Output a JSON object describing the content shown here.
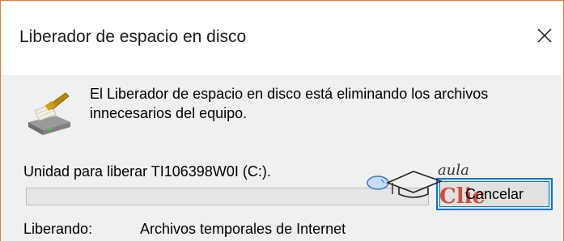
{
  "window": {
    "title": "Liberador de espacio en disco",
    "accent_color": "#0078d7",
    "border_color": "#e07b39"
  },
  "message": "El Liberador de espacio en disco está eliminando los archivos innecesarios del equipo.",
  "drive": {
    "label": "Unidad para liberar TI106398W0I (C:)."
  },
  "progress": {
    "fraction": 0.0
  },
  "buttons": {
    "cancel_label": "Cancelar"
  },
  "status": {
    "prefix": "Liberando:",
    "current_item": "Archivos temporales de Internet"
  },
  "watermark": {
    "line1": "aula",
    "line2": "Clic"
  },
  "icons": {
    "close": "close-icon",
    "app": "disk-cleanup-broom-icon"
  }
}
